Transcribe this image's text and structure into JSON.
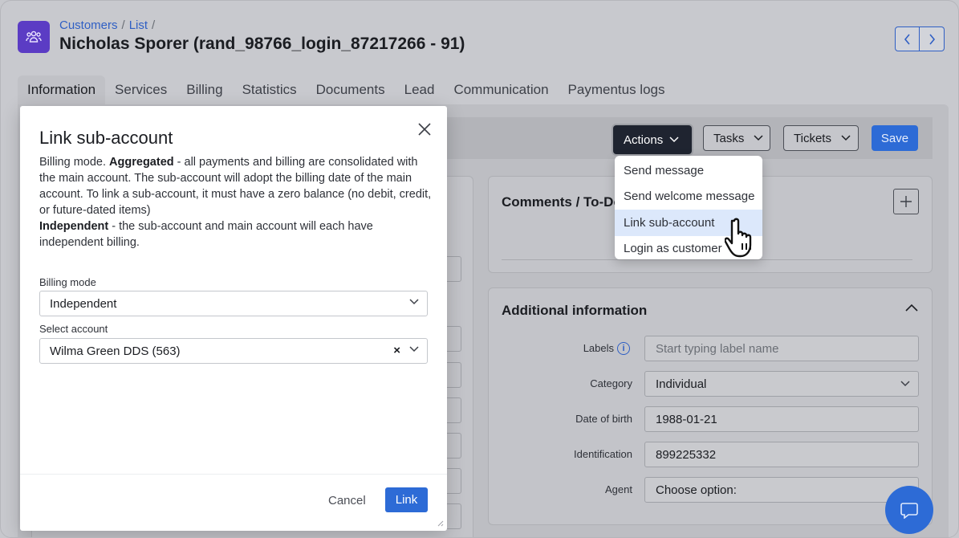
{
  "breadcrumb": {
    "customers": "Customers",
    "list": "List",
    "sep": "/"
  },
  "page_title": "Nicholas Sporer (rand_98766_login_87217266 - 91)",
  "tabs": [
    {
      "label": "Information",
      "active": true
    },
    {
      "label": "Services"
    },
    {
      "label": "Billing"
    },
    {
      "label": "Statistics"
    },
    {
      "label": "Documents"
    },
    {
      "label": "Lead"
    },
    {
      "label": "Communication"
    },
    {
      "label": "Paymentus logs"
    }
  ],
  "toolbar": {
    "actions": "Actions",
    "tasks": "Tasks",
    "tickets": "Tickets",
    "save": "Save"
  },
  "actions_menu": [
    "Send message",
    "Send welcome message",
    "Link sub-account",
    "Login as customer"
  ],
  "comments": {
    "title": "Comments / To-Do"
  },
  "additional": {
    "title": "Additional information",
    "fields": [
      {
        "label": "Labels",
        "value": "Start typing label name",
        "placeholder": true
      },
      {
        "label": "Category",
        "value": "Individual"
      },
      {
        "label": "Date of birth",
        "value": "1988-01-21"
      },
      {
        "label": "Identification",
        "value": "899225332"
      },
      {
        "label": "Agent",
        "value": "Choose option:"
      }
    ]
  },
  "modal": {
    "title": "Link sub-account",
    "desc_line1_pre": "Billing mode. ",
    "desc_line1_bold": "Aggregated",
    "desc_line1_post": " - all payments and billing are consolidated with the main account. The sub-account will adopt the billing date of the main account. To link a sub-account, it must have a zero balance (no debit, credit, or future-dated items)",
    "desc_line2_bold": "Independent",
    "desc_line2_post": " - the sub-account and main account will each have independent billing.",
    "billing_mode_label": "Billing mode",
    "billing_mode_value": "Independent",
    "select_account_label": "Select account",
    "select_account_value": "Wilma Green DDS (563)",
    "cancel": "Cancel",
    "link": "Link"
  },
  "colors": {
    "accent": "#2d6bd6",
    "brand": "#5b3cc4",
    "actions_bg": "#1f2430",
    "menu_hover": "#dce8fb"
  },
  "icons": [
    "users-icon",
    "chevron-left-icon",
    "chevron-right-icon",
    "plus-icon",
    "info-icon",
    "chevron-up-icon",
    "close-icon",
    "chat-icon",
    "hand-cursor-icon"
  ]
}
